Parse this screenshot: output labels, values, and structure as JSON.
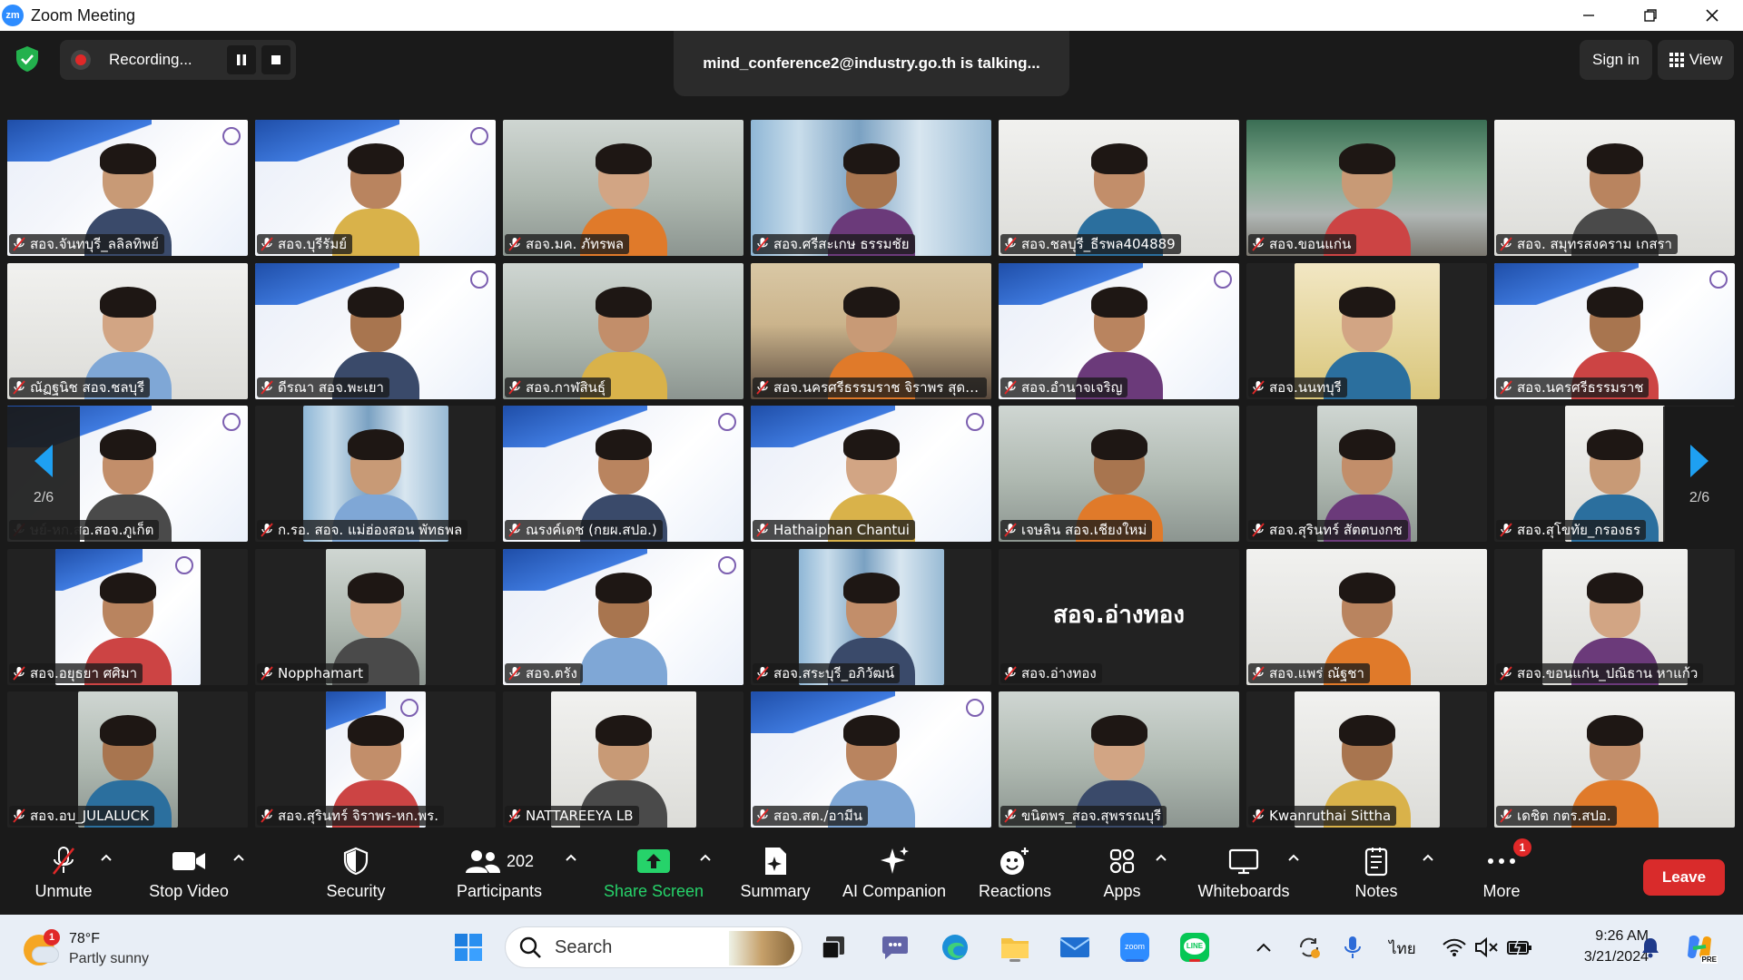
{
  "window": {
    "title": "Zoom Meeting",
    "logo_text": "zm"
  },
  "topbar": {
    "recording_label": "Recording...",
    "talking_text": "mind_conference2@industry.go.th is talking...",
    "signin_label": "Sign in",
    "view_label": "View"
  },
  "pager": {
    "left_label": "2/6",
    "right_label": "2/6"
  },
  "tiles": [
    {
      "name": "สอจ.จันทบุรี_ลลิลทิพย์",
      "bg": "slide"
    },
    {
      "name": "สอจ.บุรีรัมย์",
      "bg": "slide"
    },
    {
      "name": "สอจ.มค. ภัทรพล",
      "bg": "room"
    },
    {
      "name": "สอจ.ศรีสะเกษ ธรรมชัย",
      "bg": "curtain"
    },
    {
      "name": "สอจ.ชลบุรี_ธีรพล404889",
      "bg": "light"
    },
    {
      "name": "สอจ.ขอนแก่น",
      "bg": "greenroom"
    },
    {
      "name": "สอจ. สมุทรสงคราม เกสรา",
      "bg": "light"
    },
    {
      "name": "ณัฏฐนิช สอจ.ชลบุรี",
      "bg": "light"
    },
    {
      "name": "ดีรณา สอจ.พะเยา",
      "bg": "slide"
    },
    {
      "name": "สอจ.กาฬสินธุ์",
      "bg": "room"
    },
    {
      "name": "สอจ.นครศรีธรรมราช จิราพร สุดประเสริฐ",
      "bg": "shelf"
    },
    {
      "name": "สอจ.อำนาจเจริญ",
      "bg": "slide"
    },
    {
      "name": "สอจ.นนทบุรี",
      "bg": "dark",
      "inner": "lime"
    },
    {
      "name": "สอจ.นครศรีธรรมราช",
      "bg": "slide"
    },
    {
      "name": "ษย์-หก.สอ.สอจ.ภูเก็ต",
      "bg": "slide"
    },
    {
      "name": "ก.รอ. สอจ. แม่ฮ่องสอน พัทธพล",
      "bg": "dark",
      "inner": "curtain"
    },
    {
      "name": "ณรงค์เดช (กยผ.สปอ.)",
      "bg": "slide"
    },
    {
      "name": "Hathaiphan Chantui",
      "bg": "slide"
    },
    {
      "name": "เจษลิน สอจ.เชียงใหม่",
      "bg": "room"
    },
    {
      "name": "สอจ.สุรินทร์ สัตตบงกช",
      "bg": "dark",
      "inner": "room"
    },
    {
      "name": "สอจ.สุโขทัย_กรองธร",
      "bg": "dark",
      "inner": "light"
    },
    {
      "name": "สอจ.อยุธยา ศศิมา",
      "bg": "dark",
      "inner": "slide"
    },
    {
      "name": "Nopphamart",
      "bg": "dark",
      "inner": "room"
    },
    {
      "name": "สอจ.ตรัง",
      "bg": "slide"
    },
    {
      "name": "สอจ.สระบุรี_อภิวัฒน์",
      "bg": "dark",
      "inner": "curtain"
    },
    {
      "name": "สอจ.อ่างทอง",
      "bg": "dark",
      "initial": "สอจ.อ่างทอง"
    },
    {
      "name": "สอจ.แพร่ ณัฐชา",
      "bg": "light"
    },
    {
      "name": "สอจ.ขอนแก่น_ปณิธาน หาแก้ว",
      "bg": "dark",
      "inner": "light"
    },
    {
      "name": "สอจ.อบ_JULALUCK",
      "bg": "dark",
      "inner": "room"
    },
    {
      "name": "สอจ.สุรินทร์ จิราพร-หก.พร.",
      "bg": "dark",
      "inner": "slide"
    },
    {
      "name": "NATTAREEYA LB",
      "bg": "dark",
      "inner": "light"
    },
    {
      "name": "สอจ.สต./อามีน",
      "bg": "slide"
    },
    {
      "name": "ขนิตพร_สอจ.สุพรรณบุรี",
      "bg": "room"
    },
    {
      "name": "Kwanruthai Sittha",
      "bg": "dark",
      "inner": "light"
    },
    {
      "name": "เดชิต กตร.สปอ.",
      "bg": "light"
    }
  ],
  "toolbar": {
    "unmute": "Unmute",
    "stop_video": "Stop Video",
    "security": "Security",
    "participants": "Participants",
    "participants_count": "202",
    "share_screen": "Share Screen",
    "summary": "Summary",
    "ai_companion": "AI Companion",
    "reactions": "Reactions",
    "apps": "Apps",
    "whiteboards": "Whiteboards",
    "notes": "Notes",
    "more": "More",
    "more_badge": "1",
    "leave": "Leave"
  },
  "taskbar": {
    "weather_temp": "78°F",
    "weather_desc": "Partly sunny",
    "weather_badge": "1",
    "search_label": "Search",
    "zoom_label": "zoom",
    "line_label": "LINE",
    "language": "ไทย",
    "time": "9:26 AM",
    "date": "3/21/2024",
    "copilot_label": "PRE"
  },
  "colors": {
    "accent_green": "#26d36a",
    "leave_red": "#d92b2b",
    "pager_blue": "#1ea0f2",
    "zoom_blue": "#2d8cff"
  }
}
